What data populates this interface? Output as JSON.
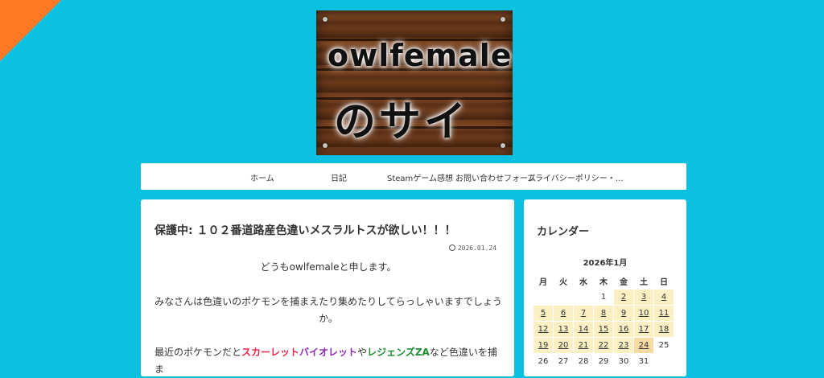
{
  "site": {
    "logo_line1": "owlfemale",
    "logo_line2": "のサイト"
  },
  "nav": {
    "items": [
      "ホーム",
      "日記",
      "Steamゲーム感想",
      "お問い合わせフォーム",
      "プライバシーポリシー・…"
    ]
  },
  "post": {
    "title": "保護中: １０２番道路産色違いメスラルトスが欲しい！！！",
    "date": "2026.01.24",
    "para1": "どうもowlfemaleと申します。",
    "para2": "みなさんは色違いのポケモンを捕まえたり集めたりしてらっしゃいますでしょうか。",
    "para3_prefix": "最近のポケモンだと",
    "para3_red": "スカーレット",
    "para3_purple": "バイオレット",
    "para3_mid": "や",
    "para3_green": "レジェンズZA",
    "para3_suffix": "など色違いを捕ま"
  },
  "sidebar": {
    "title": "カレンダー",
    "calendar": {
      "caption": "2026年1月",
      "weekdays": [
        "月",
        "火",
        "水",
        "木",
        "金",
        "土",
        "日"
      ],
      "weeks": [
        [
          "",
          "",
          "",
          "1",
          "2",
          "3",
          "4"
        ],
        [
          "5",
          "6",
          "7",
          "8",
          "9",
          "10",
          "11"
        ],
        [
          "12",
          "13",
          "14",
          "15",
          "16",
          "17",
          "18"
        ],
        [
          "19",
          "20",
          "21",
          "22",
          "23",
          "24",
          "25"
        ],
        [
          "26",
          "27",
          "28",
          "29",
          "30",
          "31",
          ""
        ]
      ]
    }
  }
}
